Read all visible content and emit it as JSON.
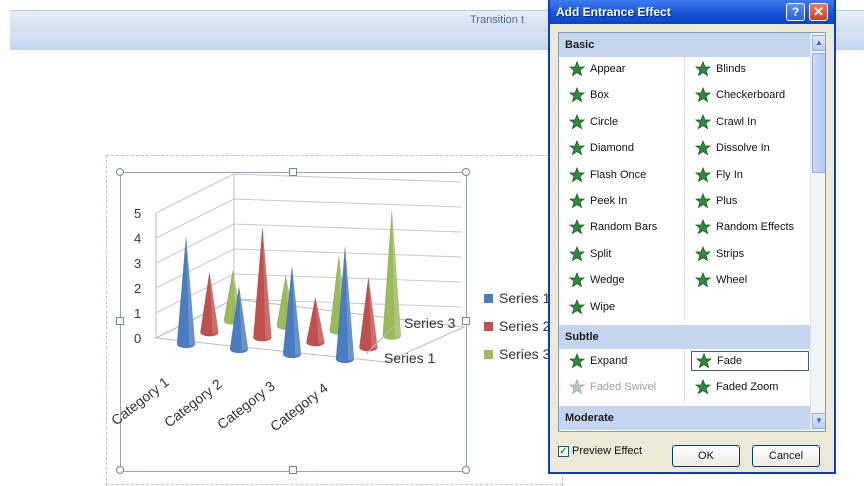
{
  "ribbon": {
    "title": "Transition t"
  },
  "dialog": {
    "title": "Add Entrance Effect",
    "help_label": "?",
    "close_label": "✕",
    "groups": [
      {
        "name": "Basic",
        "left": [
          "Appear",
          "Box",
          "Circle",
          "Diamond",
          "Flash Once",
          "Peek In",
          "Random Bars",
          "Split",
          "Wedge",
          "Wipe"
        ],
        "right": [
          "Blinds",
          "Checkerboard",
          "Crawl In",
          "Dissolve In",
          "Fly In",
          "Plus",
          "Random Effects",
          "Strips",
          "Wheel"
        ]
      },
      {
        "name": "Subtle",
        "left": [
          "Expand",
          "Faded Swivel"
        ],
        "right": [
          "Fade",
          "Faded Zoom"
        ]
      },
      {
        "name": "Moderate",
        "left": [],
        "right": []
      }
    ],
    "selected_effect": "Fade",
    "disabled_effects": [
      "Faded Swivel"
    ],
    "preview_label": "Preview Effect",
    "preview_checked": true,
    "ok_label": "OK",
    "cancel_label": "Cancel"
  },
  "chart_data": {
    "type": "bar",
    "categories": [
      "Category 1",
      "Category 2",
      "Category 3",
      "Category 4"
    ],
    "series": [
      {
        "name": "Series 1",
        "values": [
          4.3,
          2.5,
          3.5,
          4.5
        ],
        "color": "#4a7cc1"
      },
      {
        "name": "Series 2",
        "values": [
          2.4,
          4.4,
          1.8,
          2.8
        ],
        "color": "#c0504d"
      },
      {
        "name": "Series 3",
        "values": [
          2.0,
          2.0,
          3.0,
          5.0
        ],
        "color": "#9bbb59"
      }
    ],
    "depth_labels": [
      "Series 1",
      "Series 3"
    ],
    "ylim": [
      0,
      5
    ],
    "yticks": [
      "0",
      "1",
      "2",
      "3",
      "4",
      "5"
    ],
    "legend": "right"
  }
}
